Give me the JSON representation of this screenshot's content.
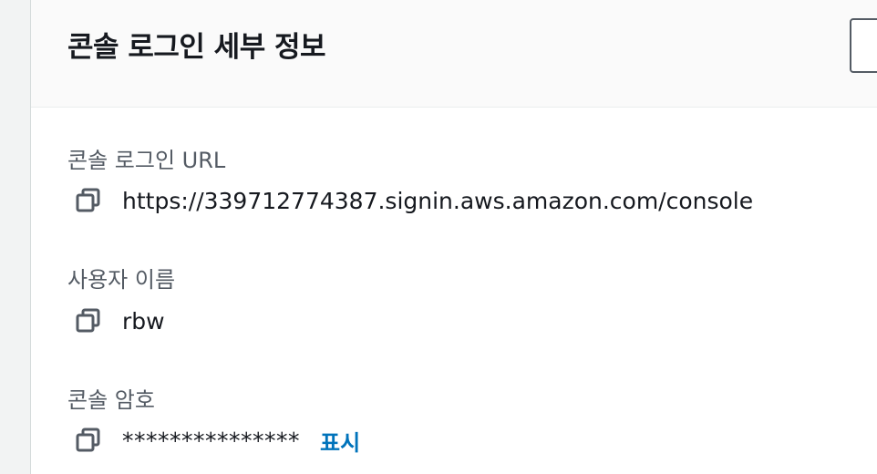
{
  "panel": {
    "title": "콘솔 로그인 세부 정보"
  },
  "fields": {
    "url": {
      "label": "콘솔 로그인 URL",
      "value": "https://339712774387.signin.aws.amazon.com/console"
    },
    "username": {
      "label": "사용자 이름",
      "value": "rbw"
    },
    "password": {
      "label": "콘솔 암호",
      "value": "***************",
      "show_label": "표시"
    }
  },
  "icons": {
    "copy": "copy-icon"
  },
  "colors": {
    "link": "#0073bb",
    "text": "#16191f",
    "label": "#545b64"
  }
}
